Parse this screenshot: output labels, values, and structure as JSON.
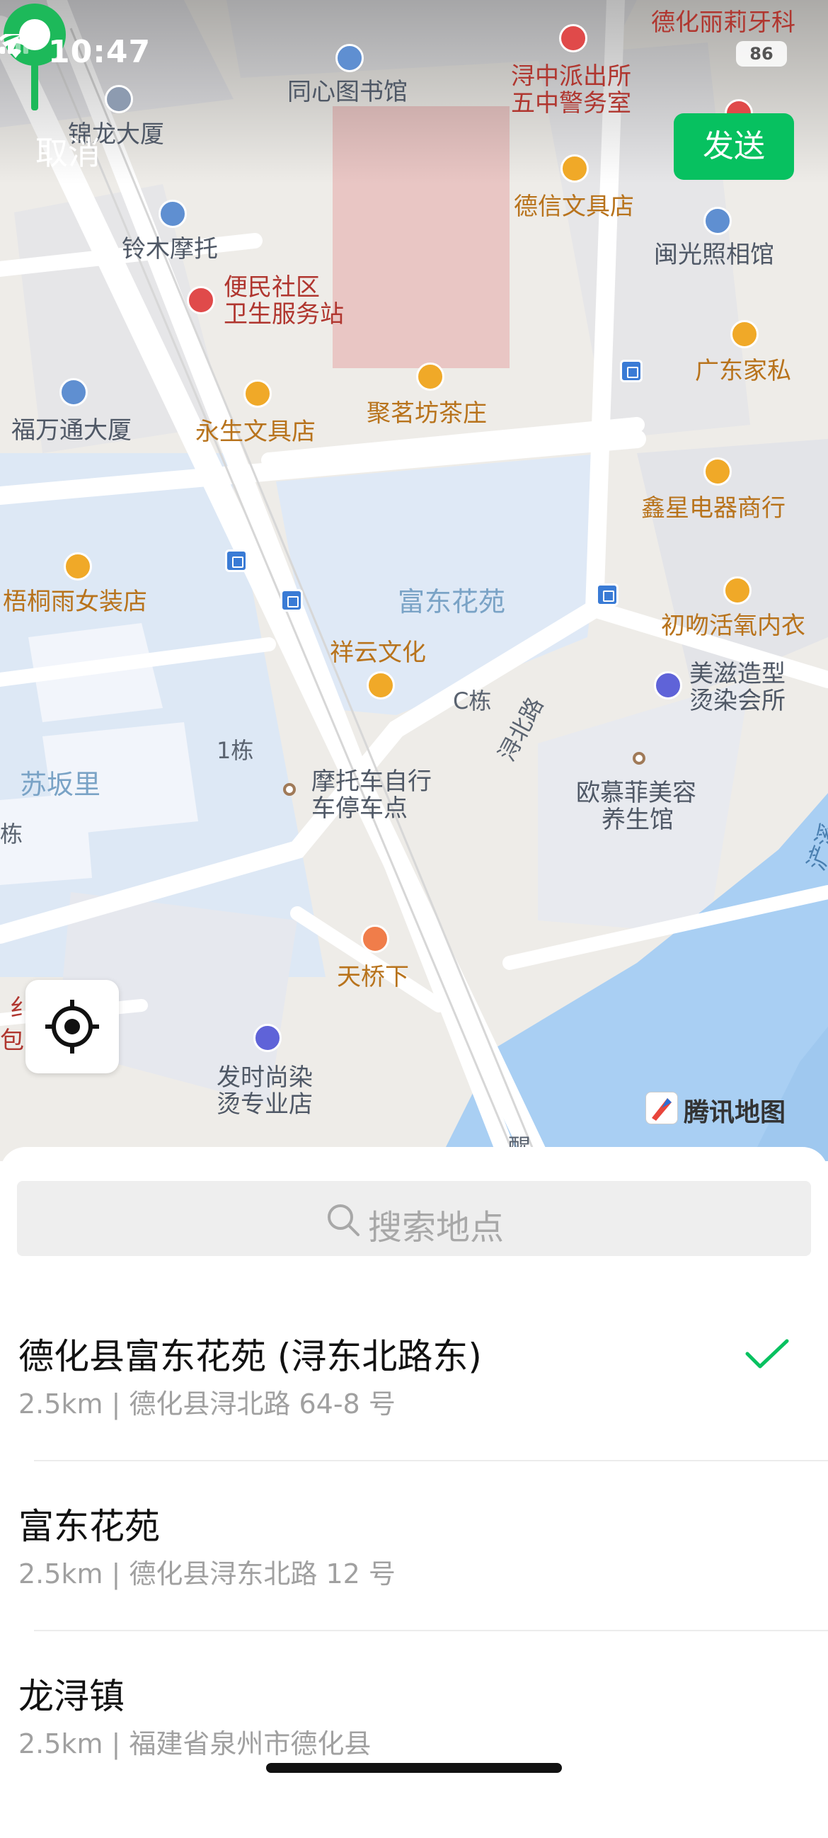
{
  "status_bar": {
    "time": "10:47",
    "battery": "86"
  },
  "top_bar": {
    "cancel": "取消",
    "send": "发送"
  },
  "map": {
    "labels": {
      "dehua_liliya": "德化丽莉牙科",
      "tongxin_library": "同心图书馆",
      "xunzhong_police_1": "浔中派出所",
      "xunzhong_police_2": "五中警务室",
      "jinlong": "锦龙大厦",
      "dexin": "德信文具店",
      "minguang": "闽光照相馆",
      "lingmu": "铃木摩托",
      "bianmin_1": "便民社区",
      "bianmin_2": "卫生服务站",
      "guangdong": "广东家私",
      "fuwantong": "福万通大厦",
      "yongsheng": "永生文具店",
      "jumingfang": "聚茗坊茶庄",
      "xinxing": "鑫星电器商行",
      "wutong": "梧桐雨女装店",
      "fudong": "富东花苑",
      "chuwen": "初吻活氧内衣",
      "xiangyun": "祥云文化",
      "meizi_1": "美滋造型",
      "meizi_2": "烫染会所",
      "c_building": "C栋",
      "xunbei_road": "浔北路",
      "sufanli": "苏坂里",
      "building_1": "1栋",
      "moto_1": "摩托车自行",
      "moto_2": "车停车点",
      "oumufei_1": "欧慕菲美容",
      "oumufei_2": "养生馆",
      "tianqiao": "天桥下",
      "fashi_1": "发时尚染",
      "fashi_2": "烫专业店",
      "river_label": "浐溪",
      "edge_dong": "栋",
      "edge_bao": "包",
      "edge_zhi": "纟",
      "bottom_road": "醒"
    },
    "brand": "腾讯地图",
    "icons": {
      "pin": "location-pin-icon",
      "locate": "locate-me-icon"
    }
  },
  "search": {
    "placeholder": "搜索地点"
  },
  "results": [
    {
      "title": "德化县富东花苑 (浔东北路东)",
      "subtitle": "2.5km | 德化县浔北路 64-8 号",
      "selected": true
    },
    {
      "title": "富东花苑",
      "subtitle": "2.5km | 德化县浔东北路 12 号",
      "selected": false
    },
    {
      "title": "龙浔镇",
      "subtitle": "2.5km | 福建省泉州市德化县",
      "selected": false
    }
  ],
  "colors": {
    "accent": "#07c160",
    "water": "#a8cdf0",
    "block": "#dce8f6"
  }
}
